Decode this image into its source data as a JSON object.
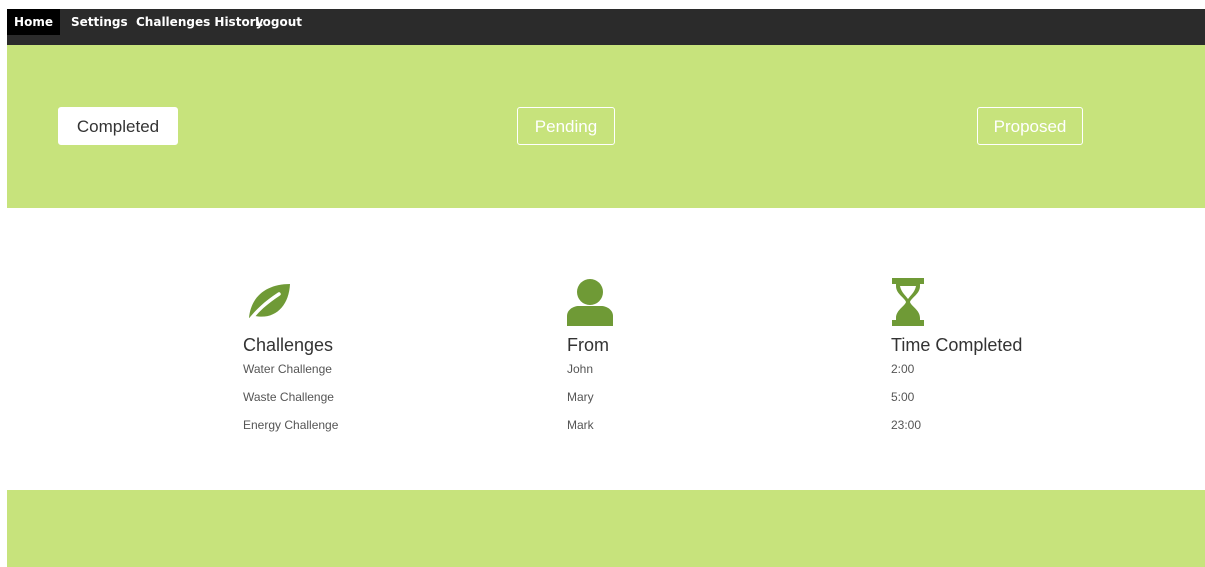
{
  "nav": {
    "items": [
      {
        "label": "Home",
        "active": true
      },
      {
        "label": "Settings",
        "active": false
      },
      {
        "label": "Challenges History",
        "active": false
      },
      {
        "label": "Logout",
        "active": false
      }
    ]
  },
  "tabs": [
    {
      "label": "Completed",
      "active": true
    },
    {
      "label": "Pending",
      "active": false
    },
    {
      "label": "Proposed",
      "active": false
    }
  ],
  "columns": [
    {
      "icon": "leaf-icon",
      "title": "Challenges",
      "rows": [
        "Water Challenge",
        "Waste Challenge",
        "Energy Challenge"
      ]
    },
    {
      "icon": "user-icon",
      "title": "From",
      "rows": [
        "John",
        "Mary",
        "Mark"
      ]
    },
    {
      "icon": "hourglass-icon",
      "title": "Time Completed",
      "rows": [
        "2:00",
        "5:00",
        "23:00"
      ]
    }
  ],
  "colors": {
    "navbar": "#2b2b2b",
    "accent_green": "#c7e37c",
    "icon_green": "#6f9a36"
  }
}
